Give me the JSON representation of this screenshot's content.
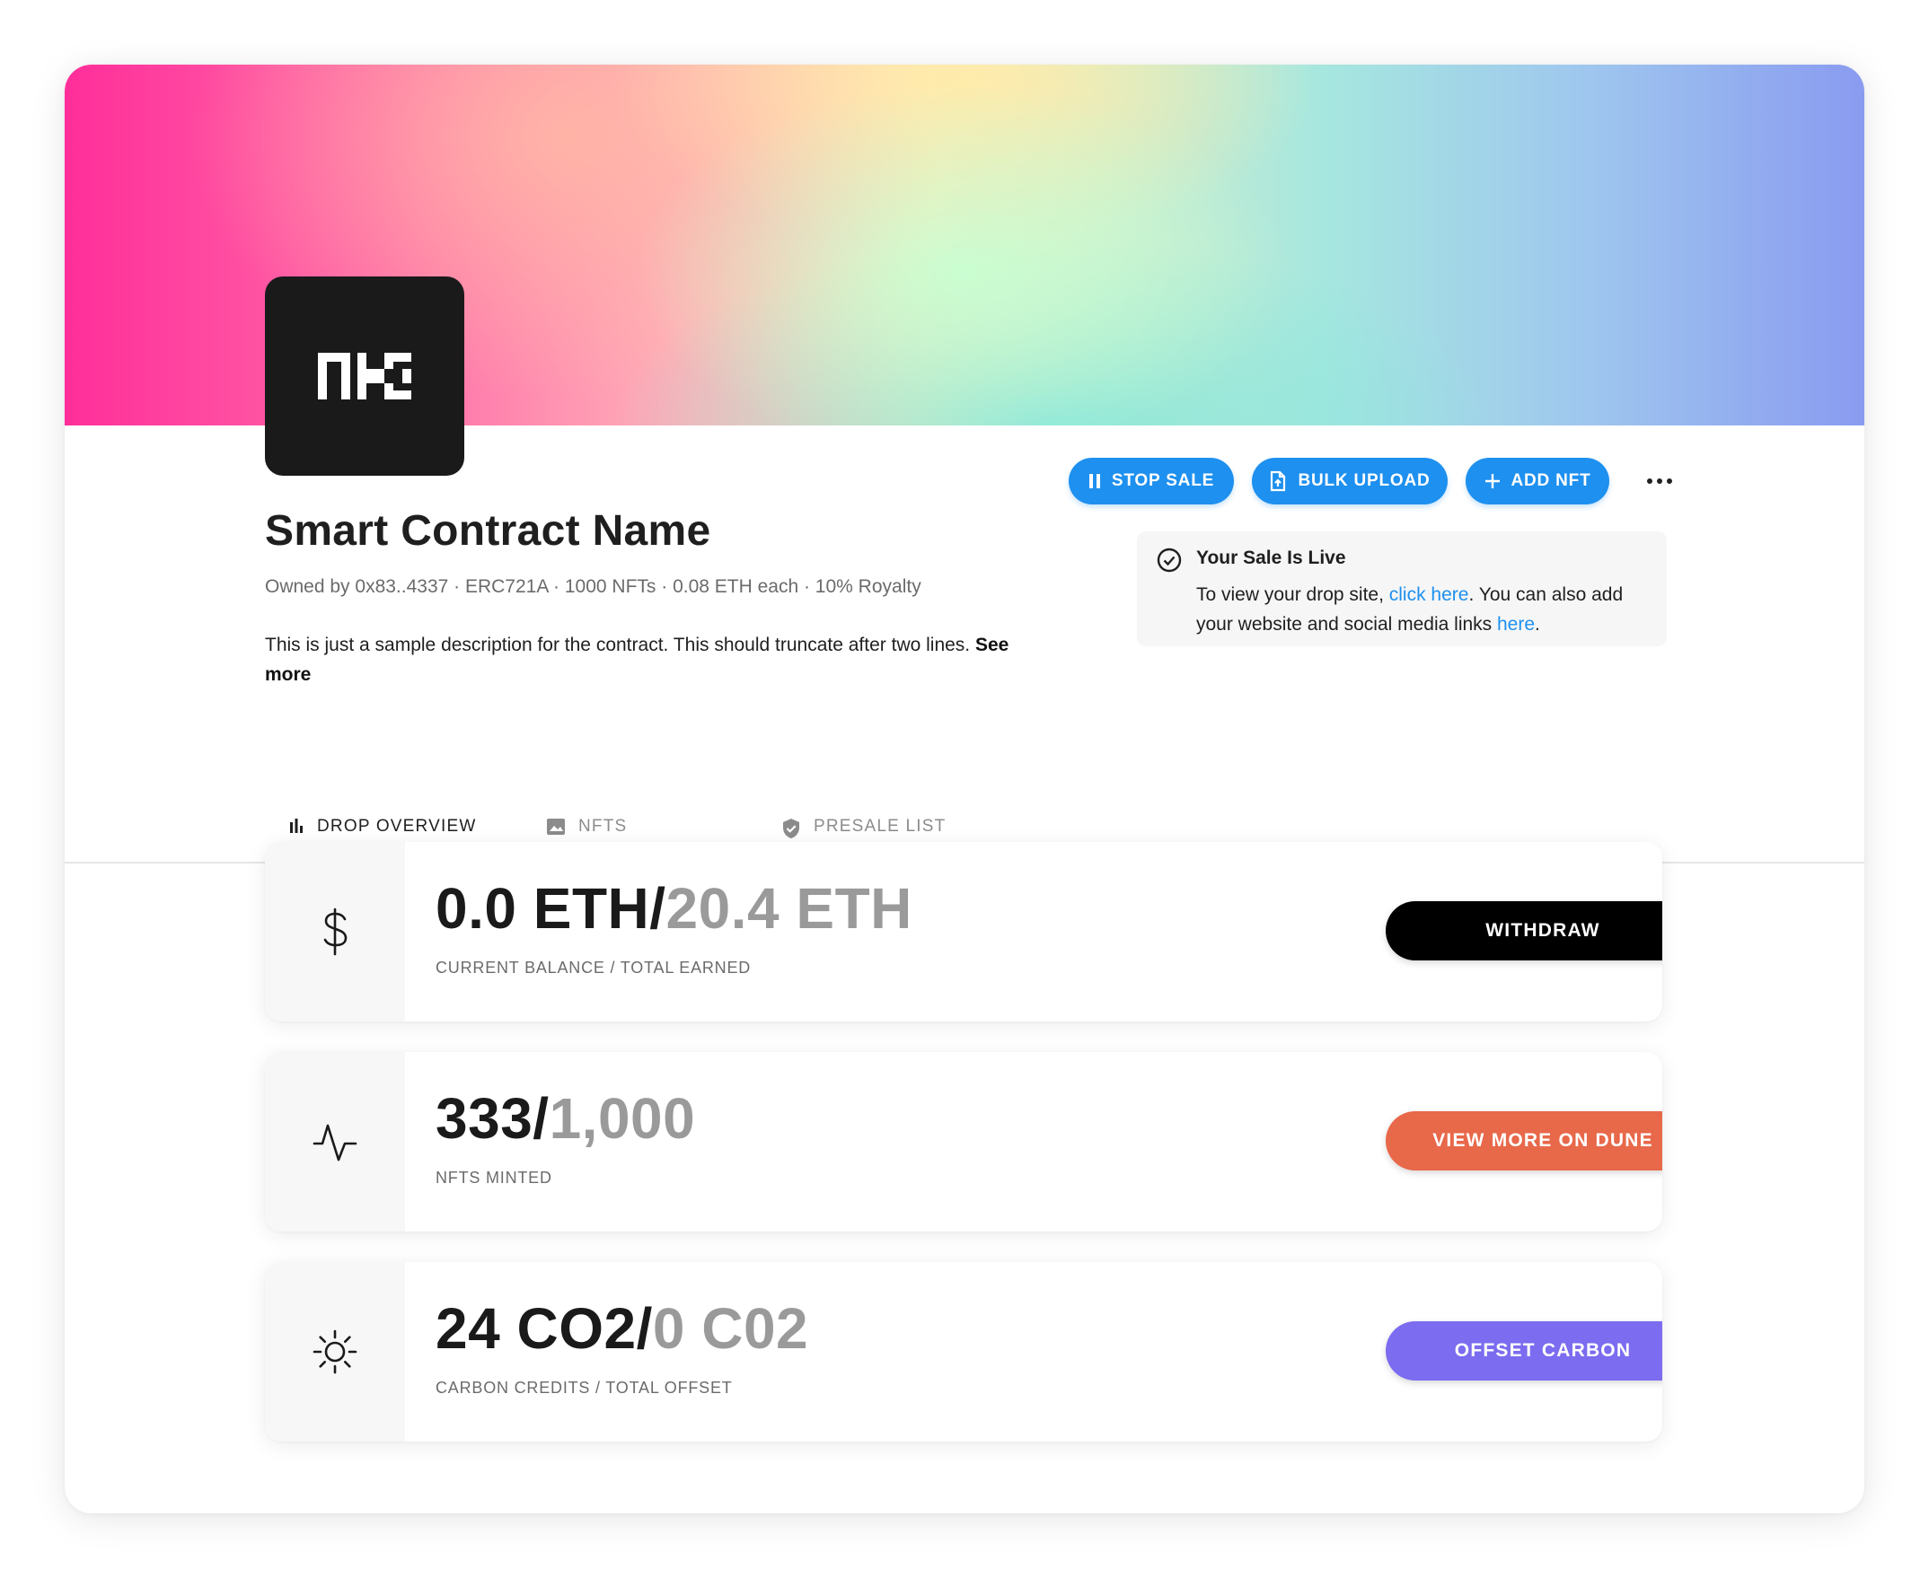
{
  "contract": {
    "name": "Smart Contract Name",
    "meta": "Owned by 0x83..4337 · ERC721A · 1000 NFTs · 0.08 ETH each · 10% Royalty",
    "description": "This is just a sample description for the contract. This should truncate after two lines.",
    "see_more": "See more",
    "logo_icon": "nk-logo"
  },
  "actions": {
    "stop_sale": "STOP SALE",
    "bulk_upload": "BULK UPLOAD",
    "add_nft": "ADD NFT",
    "accent": "#1e90ef"
  },
  "notice": {
    "title": "Your Sale Is Live",
    "text_1": "To view your drop site, ",
    "link_1": "click here",
    "text_2": ". You can also add your website and social media links ",
    "link_2": "here",
    "text_3": "."
  },
  "tabs": [
    {
      "label": "DROP OVERVIEW",
      "icon": "bar-chart-icon",
      "active": true
    },
    {
      "label": "NFTS",
      "icon": "image-icon",
      "active": false
    },
    {
      "label": "PRESALE LIST",
      "icon": "shield-icon",
      "active": false
    }
  ],
  "stats": [
    {
      "primary": "0.0 ETH",
      "sep": "/",
      "secondary": "20.4 ETH",
      "label": "CURRENT BALANCE / TOTAL EARNED",
      "button": "WITHDRAW",
      "button_color": "#000000",
      "icon": "dollar-icon"
    },
    {
      "primary": "333",
      "sep": "/",
      "secondary": "1,000",
      "label": "NFTS MINTED",
      "button": "VIEW MORE ON DUNE",
      "button_color": "#e8684a",
      "icon": "activity-icon"
    },
    {
      "primary": "24 CO2",
      "sep": "/",
      "secondary": "0 C02",
      "label": "CARBON CREDITS / TOTAL OFFSET",
      "button": "OFFSET CARBON",
      "button_color": "#7b6cf0",
      "icon": "sun-icon"
    }
  ]
}
